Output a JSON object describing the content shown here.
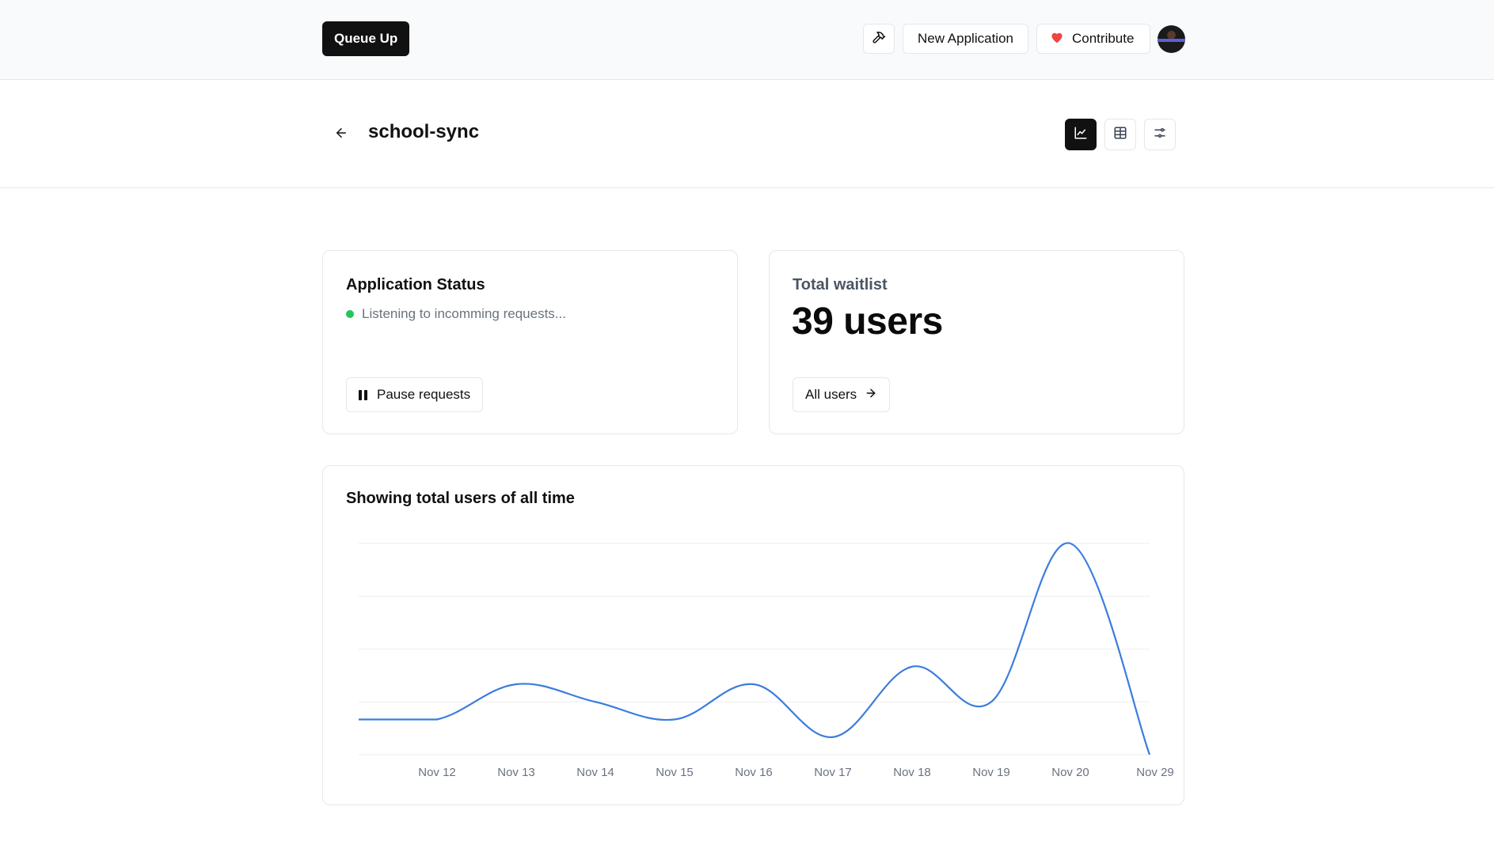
{
  "header": {
    "brand": "Queue Up",
    "new_application": "New Application",
    "contribute": "Contribute"
  },
  "app": {
    "name": "school-sync",
    "active_view": "chart"
  },
  "status_card": {
    "title": "Application Status",
    "status": "Listening to incomming requests...",
    "status_color": "#22c55e",
    "pause_label": "Pause requests"
  },
  "waitlist_card": {
    "label": "Total waitlist",
    "count": "39 users",
    "all_users_label": "All users"
  },
  "chart_card": {
    "title": "Showing total users of all time"
  },
  "chart_data": {
    "type": "area",
    "categories": [
      "Nov 12",
      "Nov 13",
      "Nov 14",
      "Nov 15",
      "Nov 16",
      "Nov 17",
      "Nov 18",
      "Nov 19",
      "Nov 20",
      "Nov 29"
    ],
    "series": [
      {
        "values": [
          2,
          4,
          3,
          2,
          4,
          1,
          5,
          3,
          12,
          0
        ],
        "color": "#3b7ddd"
      }
    ],
    "ylim": [
      0,
      12
    ],
    "grid": "horizontal",
    "xlabel": "",
    "ylabel": ""
  }
}
